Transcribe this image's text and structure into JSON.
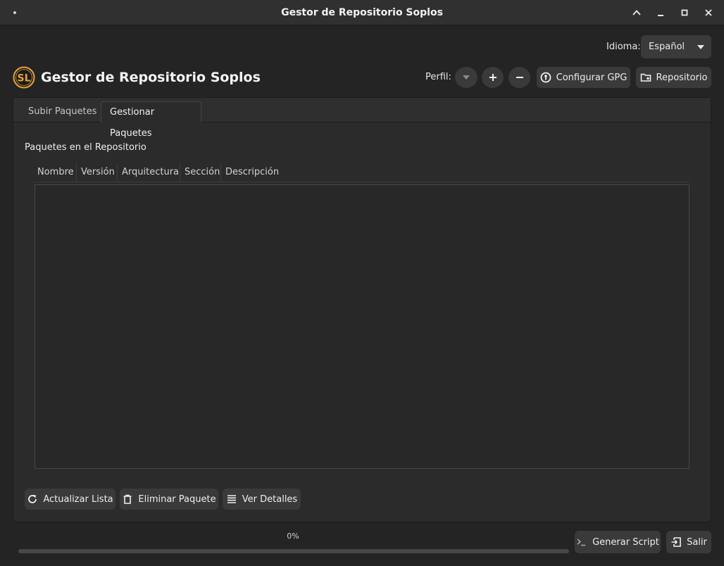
{
  "window": {
    "title": "Gestor de Repositorio Soplos"
  },
  "header": {
    "language_label": "Idioma:",
    "language_value": "Español",
    "app_title": "Gestor de Repositorio Soplos",
    "logo_text": "SL",
    "profile_label": "Perfil:",
    "profile_value": "",
    "configure_gpg_label": "Configurar GPG",
    "repository_label": "Repositorio"
  },
  "tabs": [
    {
      "label": "Subir Paquetes",
      "active": false
    },
    {
      "label": "Gestionar Paquetes",
      "active": true
    }
  ],
  "packages": {
    "section_label": "Paquetes en el Repositorio",
    "columns": [
      "Nombre",
      "Versión",
      "Arquitectura",
      "Sección",
      "Descripción"
    ],
    "rows": []
  },
  "actions": {
    "refresh_label": "Actualizar Lista",
    "delete_label": "Eliminar Paquete",
    "details_label": "Ver Detalles"
  },
  "footer": {
    "progress_percent": 0,
    "progress_text": "0%",
    "generate_script_label": "Generar Script",
    "exit_label": "Salir"
  },
  "colors": {
    "logo_accent": "#e8a23a",
    "background": "#242424"
  },
  "icons": {
    "minimize": "minimize-icon",
    "maximize": "maximize-icon",
    "close": "close-icon",
    "collapse": "chevron-up-icon",
    "gpg": "key-icon",
    "repository": "folder-icon",
    "refresh": "refresh-icon",
    "delete": "trash-icon",
    "details": "list-icon",
    "script": "terminal-icon",
    "exit": "exit-icon"
  }
}
